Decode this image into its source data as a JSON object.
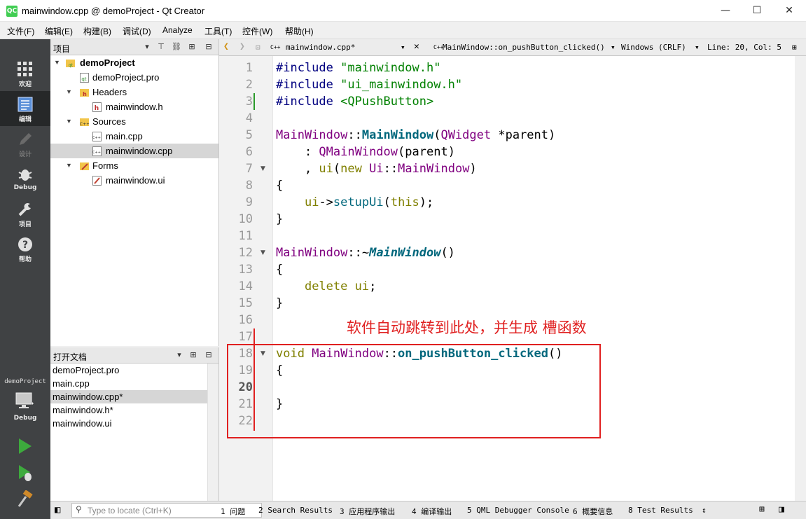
{
  "window": {
    "app_icon": "QC",
    "title": "mainwindow.cpp @ demoProject - Qt Creator",
    "minimize_icon": "—",
    "maximize_icon": "☐",
    "close_icon": "✕"
  },
  "menu": [
    "文件(F)",
    "编辑(E)",
    "构建(B)",
    "调试(D)",
    "Analyze",
    "工具(T)",
    "控件(W)",
    "帮助(H)"
  ],
  "modes": [
    {
      "label": "欢迎",
      "icon": "grid-icon"
    },
    {
      "label": "编辑",
      "icon": "edit-doc-icon"
    },
    {
      "label": "设计",
      "icon": "pencil-icon"
    },
    {
      "label": "Debug",
      "icon": "bug-icon"
    },
    {
      "label": "项目",
      "icon": "wrench-icon"
    },
    {
      "label": "帮助",
      "icon": "help-icon"
    }
  ],
  "kit": {
    "project": "demoProject",
    "build": "Debug"
  },
  "projects_panel": {
    "title": "项目",
    "tree": [
      {
        "label": "demoProject",
        "level": 0,
        "expanded": true
      },
      {
        "label": "demoProject.pro",
        "level": 1
      },
      {
        "label": "Headers",
        "level": 1,
        "expanded": true
      },
      {
        "label": "mainwindow.h",
        "level": 2
      },
      {
        "label": "Sources",
        "level": 1,
        "expanded": true
      },
      {
        "label": "main.cpp",
        "level": 2
      },
      {
        "label": "mainwindow.cpp",
        "level": 2,
        "selected": true
      },
      {
        "label": "Forms",
        "level": 1,
        "expanded": true
      },
      {
        "label": "mainwindow.ui",
        "level": 2
      }
    ]
  },
  "open_documents": {
    "title": "打开文档",
    "items": [
      "demoProject.pro",
      "main.cpp",
      "mainwindow.cpp*",
      "mainwindow.h*",
      "mainwindow.ui"
    ],
    "selected_index": 2
  },
  "editor_toolbar": {
    "file": "mainwindow.cpp*",
    "symbol": "MainWindow::on_pushButton_clicked() -…",
    "line_endings": "Windows (CRLF)",
    "position": "Line: 20, Col: 5"
  },
  "code": {
    "current_line": 20,
    "lines": [
      "#include \"mainwindow.h\"",
      "#include \"ui_mainwindow.h\"",
      "#include <QPushButton>",
      "",
      "MainWindow::MainWindow(QWidget *parent)",
      "    : QMainWindow(parent)",
      "    , ui(new Ui::MainWindow)",
      "{",
      "    ui->setupUi(this);",
      "}",
      "",
      "MainWindow::~MainWindow()",
      "{",
      "    delete ui;",
      "}",
      "",
      "",
      "void MainWindow::on_pushButton_clicked()",
      "{",
      "",
      "}",
      ""
    ]
  },
  "annotation": "软件自动跳转到此处，并生成 槽函数",
  "statusbar": {
    "locator_placeholder": "Type to locate (Ctrl+K)",
    "panes": [
      "1 问题",
      "2 Search Results",
      "3 应用程序输出",
      "4 编译输出",
      "5 QML Debugger Console",
      "6 概要信息",
      "8 Test Results"
    ]
  },
  "colors": {
    "annotation": "#e02020",
    "mode_bar": "#404244",
    "run_green": "#3daa3d"
  }
}
